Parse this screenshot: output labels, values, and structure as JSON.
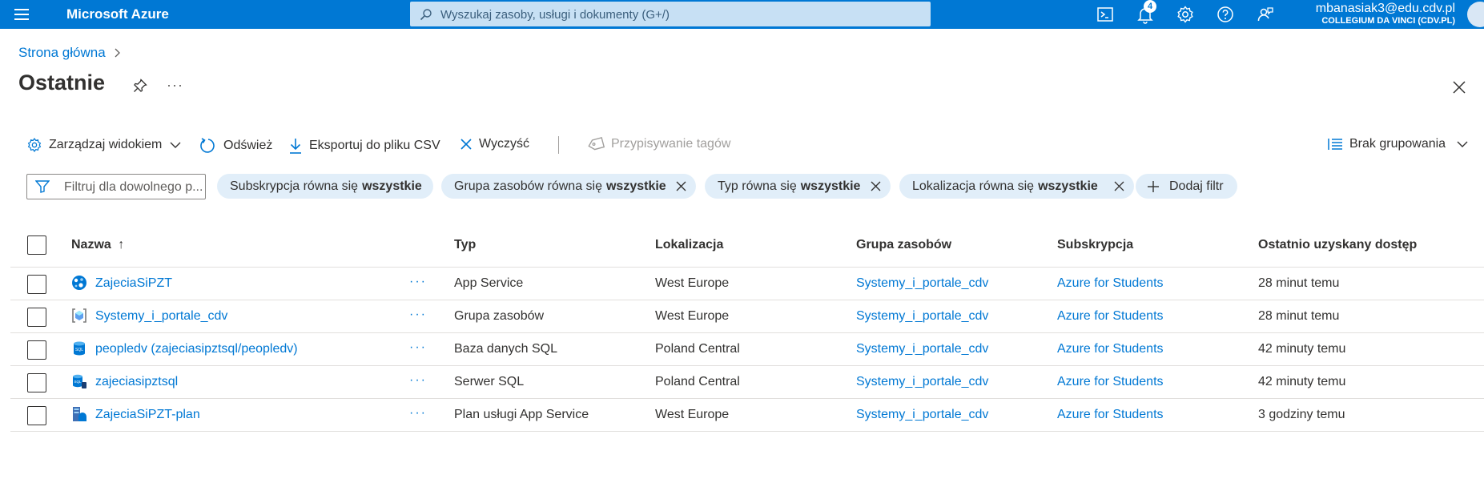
{
  "topbar": {
    "brand": "Microsoft Azure",
    "search_placeholder": "Wyszukaj zasoby, usługi i dokumenty (G+/)",
    "notifications_count": "4",
    "account_email": "mbanasiak3@edu.cdv.pl",
    "account_org": "COLLEGIUM DA VINCI (CDV.PL)",
    "icons": [
      "menu-icon",
      "search-icon",
      "cloud-shell-icon",
      "notifications-icon",
      "settings-icon",
      "help-icon",
      "feedback-icon"
    ]
  },
  "breadcrumb": {
    "home": "Strona główna"
  },
  "page": {
    "title": "Ostatnie",
    "more": "···"
  },
  "toolbar": {
    "manage_view": "Zarządzaj widokiem",
    "refresh": "Odśwież",
    "export_csv": "Eksportuj do pliku CSV",
    "clear": "Wyczyść",
    "assign_tags": "Przypisywanie tagów",
    "grouping": "Brak grupowania"
  },
  "filters": {
    "placeholder": "Filtruj dla dowolnego p...",
    "pills": [
      {
        "prefix": "Subskrypcja równa się",
        "value": "wszystkie"
      },
      {
        "prefix": "Grupa zasobów równa się",
        "value": "wszystkie"
      },
      {
        "prefix": "Typ równa się",
        "value": "wszystkie"
      },
      {
        "prefix": "Lokalizacja równa się",
        "value": "wszystkie"
      }
    ],
    "add_filter": "Dodaj filtr"
  },
  "table": {
    "columns": {
      "name": "Nazwa",
      "sort_indicator": "↑",
      "type": "Typ",
      "location": "Lokalizacja",
      "resource_group": "Grupa zasobów",
      "subscription": "Subskrypcja",
      "last_accessed": "Ostatnio uzyskany dostęp"
    },
    "rows": [
      {
        "name": "ZajeciaSiPZT",
        "icon": "app-service-icon",
        "more": "···",
        "type": "App Service",
        "location": "West Europe",
        "resource_group": "Systemy_i_portale_cdv",
        "subscription": "Azure for Students",
        "last_accessed": "28 minut temu"
      },
      {
        "name": "Systemy_i_portale_cdv",
        "icon": "resource-group-icon",
        "more": "···",
        "type": "Grupa zasobów",
        "location": "West Europe",
        "resource_group": "Systemy_i_portale_cdv",
        "subscription": "Azure for Students",
        "last_accessed": "28 minut temu"
      },
      {
        "name": "peopledv (zajeciasipztsql/peopledv)",
        "icon": "sql-database-icon",
        "more": "···",
        "type": "Baza danych SQL",
        "location": "Poland Central",
        "resource_group": "Systemy_i_portale_cdv",
        "subscription": "Azure for Students",
        "last_accessed": "42 minuty temu"
      },
      {
        "name": "zajeciasipztsql",
        "icon": "sql-server-icon",
        "more": "···",
        "type": "Serwer SQL",
        "location": "Poland Central",
        "resource_group": "Systemy_i_portale_cdv",
        "subscription": "Azure for Students",
        "last_accessed": "42 minuty temu"
      },
      {
        "name": "ZajeciaSiPZT-plan",
        "icon": "app-service-plan-icon",
        "more": "···",
        "type": "Plan usługi App Service",
        "location": "West Europe",
        "resource_group": "Systemy_i_portale_cdv",
        "subscription": "Azure for Students",
        "last_accessed": "3 godziny temu"
      }
    ]
  },
  "colors": {
    "accent": "#0078d4",
    "pill_bg": "#e1eef9",
    "search_bg": "#c7e0f4"
  }
}
